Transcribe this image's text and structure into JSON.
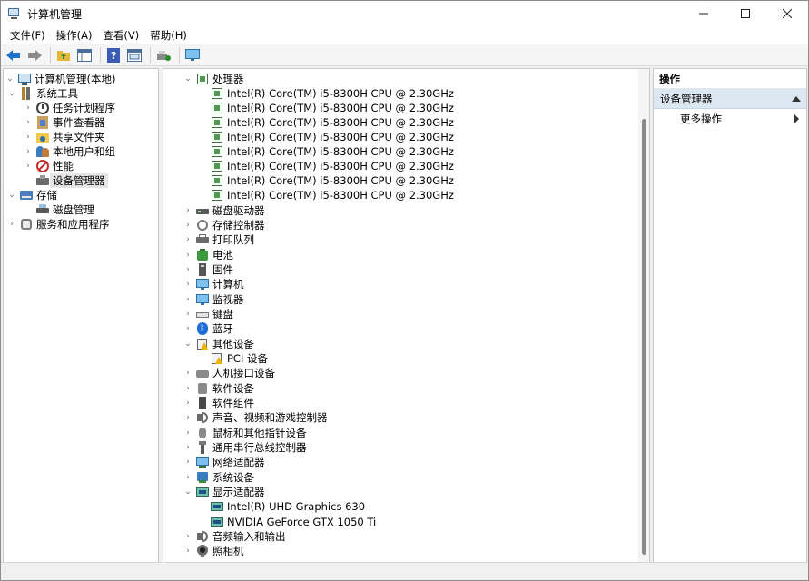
{
  "window": {
    "title": "计算机管理"
  },
  "menu": [
    "文件(F)",
    "操作(A)",
    "查看(V)",
    "帮助(H)"
  ],
  "toolbar": {
    "buttons": [
      "back-icon",
      "forward-icon",
      "up-folder-icon",
      "show-hide-tree-icon",
      "help-icon",
      "properties-icon",
      "scan-hardware-icon",
      "monitor-icon"
    ]
  },
  "left_tree": [
    {
      "label": "计算机管理(本地)",
      "level": 0,
      "expanded": true,
      "icon": "computer-management-icon"
    },
    {
      "label": "系统工具",
      "level": 1,
      "expanded": true,
      "icon": "system-tools-icon"
    },
    {
      "label": "任务计划程序",
      "level": 2,
      "expanded": false,
      "icon": "task-scheduler-icon"
    },
    {
      "label": "事件查看器",
      "level": 2,
      "expanded": false,
      "icon": "event-viewer-icon"
    },
    {
      "label": "共享文件夹",
      "level": 2,
      "expanded": false,
      "icon": "shared-folders-icon"
    },
    {
      "label": "本地用户和组",
      "level": 2,
      "expanded": false,
      "icon": "local-users-icon"
    },
    {
      "label": "性能",
      "level": 2,
      "expanded": false,
      "icon": "performance-icon"
    },
    {
      "label": "设备管理器",
      "level": 2,
      "expanded": null,
      "icon": "device-manager-icon",
      "selected": true
    },
    {
      "label": "存储",
      "level": 1,
      "expanded": true,
      "icon": "storage-icon"
    },
    {
      "label": "磁盘管理",
      "level": 2,
      "expanded": null,
      "icon": "disk-management-icon"
    },
    {
      "label": "服务和应用程序",
      "level": 1,
      "expanded": false,
      "icon": "services-apps-icon"
    }
  ],
  "device_tree": [
    {
      "label": "处理器",
      "level": 0,
      "expanded": true,
      "icon": "processor-icon"
    },
    {
      "label": "Intel(R) Core(TM) i5-8300H CPU @ 2.30GHz",
      "level": 1,
      "icon": "processor-icon"
    },
    {
      "label": "Intel(R) Core(TM) i5-8300H CPU @ 2.30GHz",
      "level": 1,
      "icon": "processor-icon"
    },
    {
      "label": "Intel(R) Core(TM) i5-8300H CPU @ 2.30GHz",
      "level": 1,
      "icon": "processor-icon"
    },
    {
      "label": "Intel(R) Core(TM) i5-8300H CPU @ 2.30GHz",
      "level": 1,
      "icon": "processor-icon"
    },
    {
      "label": "Intel(R) Core(TM) i5-8300H CPU @ 2.30GHz",
      "level": 1,
      "icon": "processor-icon"
    },
    {
      "label": "Intel(R) Core(TM) i5-8300H CPU @ 2.30GHz",
      "level": 1,
      "icon": "processor-icon"
    },
    {
      "label": "Intel(R) Core(TM) i5-8300H CPU @ 2.30GHz",
      "level": 1,
      "icon": "processor-icon"
    },
    {
      "label": "Intel(R) Core(TM) i5-8300H CPU @ 2.30GHz",
      "level": 1,
      "icon": "processor-icon"
    },
    {
      "label": "磁盘驱动器",
      "level": 0,
      "expanded": false,
      "icon": "disk-drive-icon"
    },
    {
      "label": "存储控制器",
      "level": 0,
      "expanded": false,
      "icon": "storage-controller-icon"
    },
    {
      "label": "打印队列",
      "level": 0,
      "expanded": false,
      "icon": "printer-icon"
    },
    {
      "label": "电池",
      "level": 0,
      "expanded": false,
      "icon": "battery-icon"
    },
    {
      "label": "固件",
      "level": 0,
      "expanded": false,
      "icon": "firmware-icon"
    },
    {
      "label": "计算机",
      "level": 0,
      "expanded": false,
      "icon": "computer-icon"
    },
    {
      "label": "监视器",
      "level": 0,
      "expanded": false,
      "icon": "monitor-icon"
    },
    {
      "label": "键盘",
      "level": 0,
      "expanded": false,
      "icon": "keyboard-icon"
    },
    {
      "label": "蓝牙",
      "level": 0,
      "expanded": false,
      "icon": "bluetooth-icon"
    },
    {
      "label": "其他设备",
      "level": 0,
      "expanded": true,
      "icon": "other-devices-icon"
    },
    {
      "label": "PCI 设备",
      "level": 1,
      "icon": "warning-device-icon"
    },
    {
      "label": "人机接口设备",
      "level": 0,
      "expanded": false,
      "icon": "hid-icon"
    },
    {
      "label": "软件设备",
      "level": 0,
      "expanded": false,
      "icon": "software-device-icon"
    },
    {
      "label": "软件组件",
      "level": 0,
      "expanded": false,
      "icon": "software-component-icon"
    },
    {
      "label": "声音、视频和游戏控制器",
      "level": 0,
      "expanded": false,
      "icon": "sound-icon"
    },
    {
      "label": "鼠标和其他指针设备",
      "level": 0,
      "expanded": false,
      "icon": "mouse-icon"
    },
    {
      "label": "通用串行总线控制器",
      "level": 0,
      "expanded": false,
      "icon": "usb-icon"
    },
    {
      "label": "网络适配器",
      "level": 0,
      "expanded": false,
      "icon": "network-adapter-icon"
    },
    {
      "label": "系统设备",
      "level": 0,
      "expanded": false,
      "icon": "system-device-icon"
    },
    {
      "label": "显示适配器",
      "level": 0,
      "expanded": true,
      "icon": "display-adapter-icon"
    },
    {
      "label": "Intel(R) UHD Graphics 630",
      "level": 1,
      "icon": "display-adapter-icon"
    },
    {
      "label": "NVIDIA GeForce GTX 1050 Ti",
      "level": 1,
      "icon": "display-adapter-icon"
    },
    {
      "label": "音频输入和输出",
      "level": 0,
      "expanded": false,
      "icon": "audio-io-icon"
    },
    {
      "label": "照相机",
      "level": 0,
      "expanded": false,
      "icon": "camera-icon"
    }
  ],
  "actions_pane": {
    "header": "操作",
    "section": "设备管理器",
    "item": "更多操作"
  }
}
